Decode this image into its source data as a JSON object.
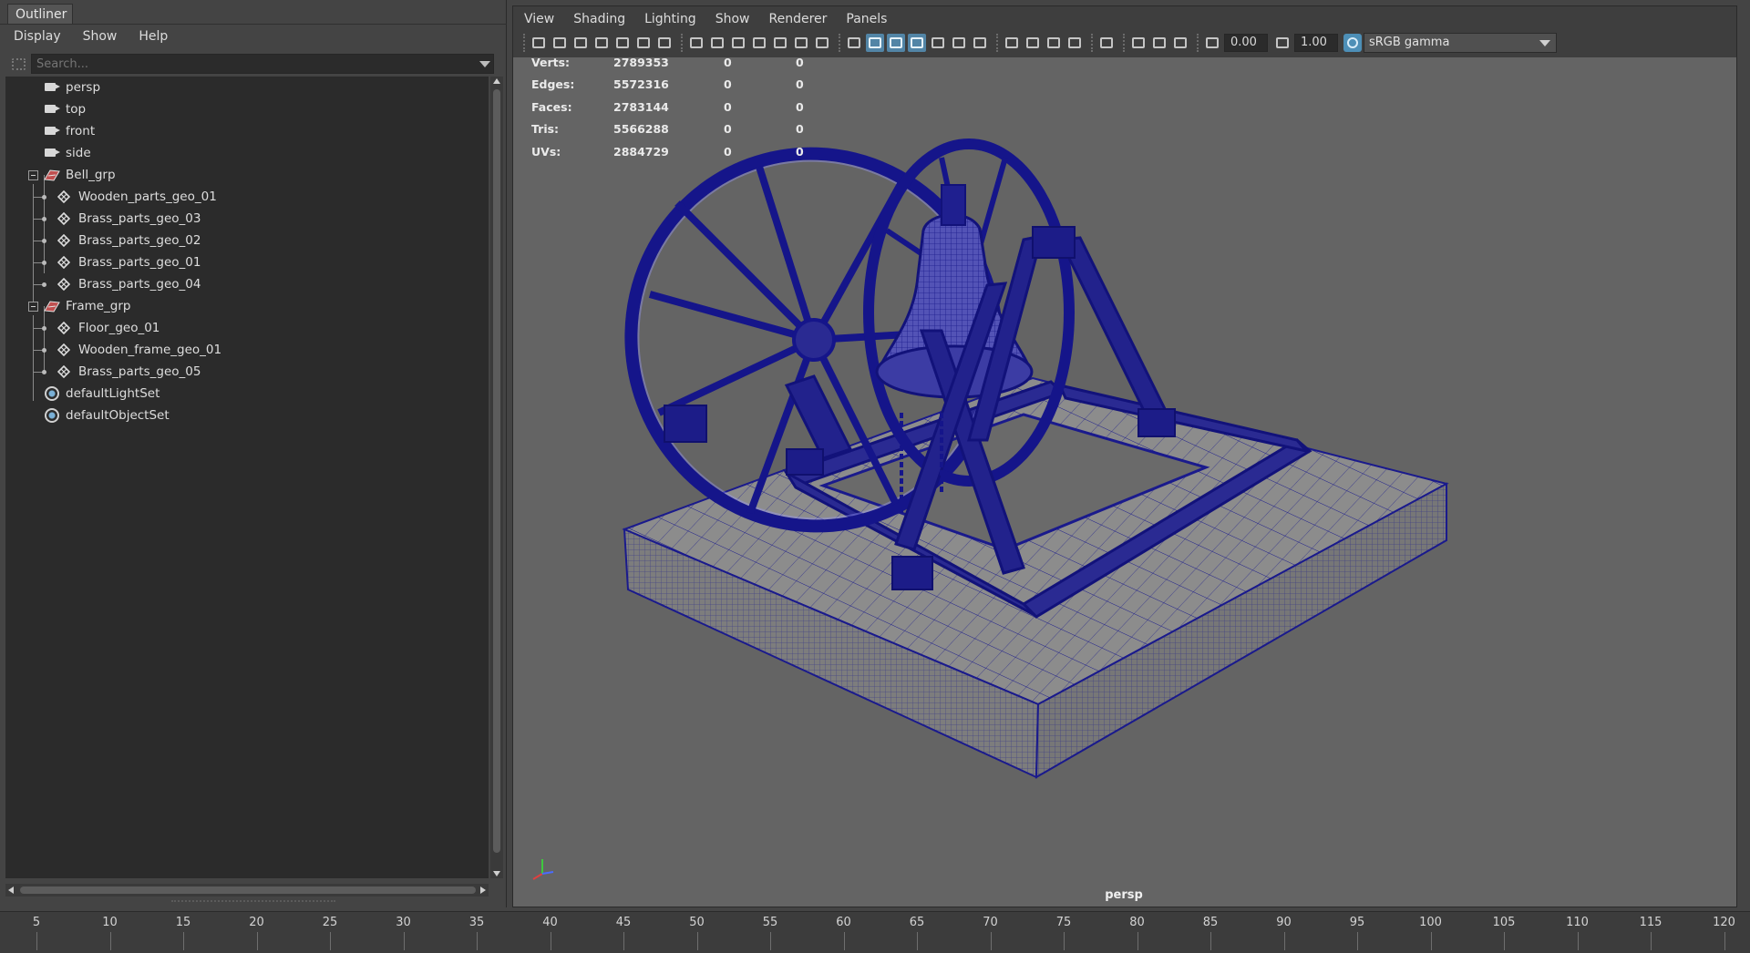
{
  "outliner": {
    "title": "Outliner",
    "menu": [
      "Display",
      "Show",
      "Help"
    ],
    "search_placeholder": "Search...",
    "items": [
      {
        "label": "persp",
        "type": "camera",
        "depth": 0
      },
      {
        "label": "top",
        "type": "camera",
        "depth": 0
      },
      {
        "label": "front",
        "type": "camera",
        "depth": 0
      },
      {
        "label": "side",
        "type": "camera",
        "depth": 0
      },
      {
        "label": "Bell_grp",
        "type": "group",
        "depth": 0,
        "expanded": true
      },
      {
        "label": "Wooden_parts_geo_01",
        "type": "mesh",
        "depth": 1
      },
      {
        "label": "Brass_parts_geo_03",
        "type": "mesh",
        "depth": 1
      },
      {
        "label": "Brass_parts_geo_02",
        "type": "mesh",
        "depth": 1
      },
      {
        "label": "Brass_parts_geo_01",
        "type": "mesh",
        "depth": 1
      },
      {
        "label": "Brass_parts_geo_04",
        "type": "mesh",
        "depth": 1
      },
      {
        "label": "Frame_grp",
        "type": "group",
        "depth": 0,
        "expanded": true
      },
      {
        "label": "Floor_geo_01",
        "type": "mesh",
        "depth": 1
      },
      {
        "label": "Wooden_frame_geo_01",
        "type": "mesh",
        "depth": 1
      },
      {
        "label": "Brass_parts_geo_05",
        "type": "mesh",
        "depth": 1
      },
      {
        "label": "defaultLightSet",
        "type": "set",
        "depth": 0
      },
      {
        "label": "defaultObjectSet",
        "type": "set",
        "depth": 0
      }
    ]
  },
  "viewport": {
    "menu": [
      "View",
      "Shading",
      "Lighting",
      "Show",
      "Renderer",
      "Panels"
    ],
    "toolbar": {
      "exposure": "0.00",
      "gamma": "1.00",
      "color_space": "sRGB gamma"
    },
    "hud": [
      {
        "label": "Verts:",
        "scene": "2789353",
        "selected": "0",
        "component": "0"
      },
      {
        "label": "Edges:",
        "scene": "5572316",
        "selected": "0",
        "component": "0"
      },
      {
        "label": "Faces:",
        "scene": "2783144",
        "selected": "0",
        "component": "0"
      },
      {
        "label": "Tris:",
        "scene": "5566288",
        "selected": "0",
        "component": "0"
      },
      {
        "label": "UVs:",
        "scene": "2884729",
        "selected": "0",
        "component": "0"
      }
    ],
    "camera": "persp",
    "wire_color": "#1a1a8c",
    "viewport_bg": "#646464"
  },
  "timeline": {
    "ticks": [
      "5",
      "10",
      "15",
      "20",
      "25",
      "30",
      "35",
      "40",
      "45",
      "50",
      "55",
      "60",
      "65",
      "70",
      "75",
      "80",
      "85",
      "90",
      "95",
      "100",
      "105",
      "110",
      "115",
      "120"
    ]
  }
}
